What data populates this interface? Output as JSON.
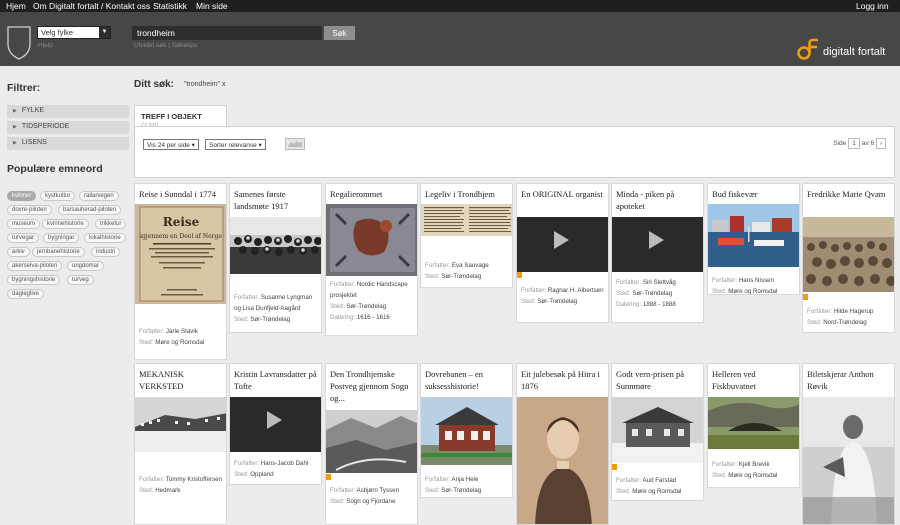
{
  "topnav": {
    "home": "Hjem",
    "about": "Om Digitalt fortalt / Kontakt oss",
    "stats": "Statistikk",
    "mypage": "Min side",
    "login": "Logg inn"
  },
  "header": {
    "county_select": "Velg fylke",
    "help": "Hjelp",
    "search_value": "trondheim",
    "search_button": "Søk",
    "search_sub": "Utvidet søk  |  Søketips",
    "logo_text": "digitalt fortalt",
    "accent": "#f39c12"
  },
  "sidebar": {
    "filter_title": "Filtrer:",
    "filters": [
      "FYLKE",
      "TIDSPERIODE",
      "LISENS"
    ],
    "popular_title": "Populære emneord",
    "tags": [
      "kvinner",
      "kystkultur",
      "rallarvegen",
      "dovre-piloten",
      "ba/sauherad-piloten",
      "museum",
      "kvinnehistorie",
      "trikketur",
      "turvegar",
      "bygningar",
      "lokalhistorie",
      "arkiv",
      "jernbanehistorie",
      "industri",
      "akerselva-piloten",
      "ungdomar",
      "bygningshistorie",
      "turveg",
      "dagleglive"
    ]
  },
  "results": {
    "search_label": "Ditt søk:",
    "search_term": "\"trondheim\" x",
    "tab_label": "TREFF I OBJEKT",
    "tab_count": "(135)",
    "per_page": "Vis 24 per side ▾",
    "sort": "Sorter relevanse ▾",
    "page_label": "Side",
    "page_current": "1",
    "page_of": "av 6",
    "next": "›"
  },
  "labels": {
    "author": "Forfatter:",
    "place": "Sted:",
    "dating": "Datering:"
  },
  "cards": [
    {
      "title": "Reise i Sunndal i 1774",
      "author": "Jarle Stavik",
      "place": "Møre og Romsdal",
      "dating": ""
    },
    {
      "title": "Samenes første landsmøte 1917",
      "author": "Susanne Lyngman og Lisa Dunfjeld-Aagård",
      "place": "Sør-Trøndelag",
      "dating": ""
    },
    {
      "title": "Regalierommet",
      "author": "Nordic Handscape prosjektet",
      "place": "Sør-Trøndelag",
      "dating": "1616 - 1616"
    },
    {
      "title": "Legeliv i Trondhjem",
      "author": "Eva Sauvage",
      "place": "Sør-Trøndelag",
      "dating": ""
    },
    {
      "title": "En ORIGINAL organist",
      "author": "Ragnar H. Albertsen",
      "place": "Sør-Trøndelag",
      "dating": ""
    },
    {
      "title": "Minda - piken på apoteket",
      "author": "Siri Slettvåg",
      "place": "Sør-Trøndelag",
      "dating": "1888 - 1888"
    },
    {
      "title": "Bud fiskevær",
      "author": "Hans Nissen",
      "place": "Møre og Romsdal",
      "dating": ""
    },
    {
      "title": "Fredrikke Marie Qvam",
      "author": "Hilde Hagerup",
      "place": "Nord-Trøndelag",
      "dating": ""
    },
    {
      "title": "MEKANISK VERKSTED",
      "author": "Tommy Kristoffersen",
      "place": "Hedmark",
      "dating": ""
    },
    {
      "title": "Kristin Lavransdatter på Tofte",
      "author": "Hans-Jacob Dahl",
      "place": "Oppland",
      "dating": ""
    },
    {
      "title": "Den Trondhjemske Postveg gjennom Sogn og...",
      "author": "Asbjørn Tyssen",
      "place": "Sogn og Fjordane",
      "dating": ""
    },
    {
      "title": "Dovrebanen – en suksesshistorie!",
      "author": "Anja Heie",
      "place": "Sør-Trøndelag",
      "dating": ""
    },
    {
      "title": "Eit julebesøk på Hitra i 1876",
      "author": "",
      "place": "",
      "dating": ""
    },
    {
      "title": "Godt vern-prisen på Sunnmøre",
      "author": "Aud Farstad",
      "place": "Møre og Romsdal",
      "dating": ""
    },
    {
      "title": "Helleren ved Fiskbuvatnet",
      "author": "Kjell Brevik",
      "place": "Møre og Romsdal",
      "dating": ""
    },
    {
      "title": "Biletskjerar Anthon Røvik",
      "author": "",
      "place": "",
      "dating": ""
    }
  ]
}
